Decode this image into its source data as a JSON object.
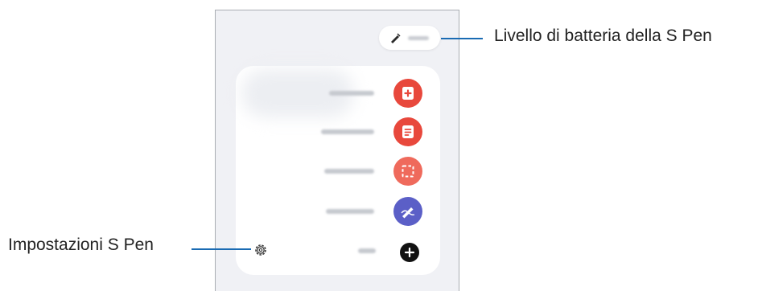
{
  "callouts": {
    "battery_level": "Livello di batteria della S Pen",
    "settings": "Impostazioni S Pen"
  },
  "icons": {
    "battery_pill": "pen-icon",
    "create_note": "note-add-icon",
    "view_all_notes": "notes-list-icon",
    "smart_select": "smart-select-icon",
    "screen_write": "screen-write-icon",
    "add": "plus-circle-icon",
    "settings": "gear-icon"
  },
  "colors": {
    "red_button": "#e8483c",
    "smart_select_button": "#ef6a5c",
    "screen_write_button": "#5b5fc7",
    "callout_line": "#1a6bb3"
  }
}
